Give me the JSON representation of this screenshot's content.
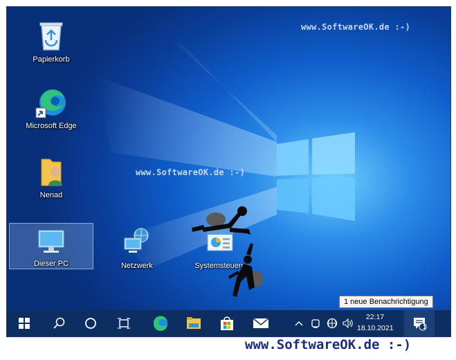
{
  "watermarks": {
    "top_right": "www.SoftwareOK.de :-)",
    "center": "www.SoftwareOK.de :-)",
    "footer": "www.SoftwareOK.de :-)"
  },
  "desktop_icons": {
    "recycle_bin": "Papierkorb",
    "edge": "Microsoft Edge",
    "user": "Nenad",
    "this_pc": "Dieser PC",
    "network": "Netzwerk",
    "control_panel": "Systemsteueru"
  },
  "taskbar": {
    "pinned": [
      "start-icon",
      "search-icon",
      "cortana-icon",
      "task-view-icon",
      "edge-icon",
      "file-explorer-icon",
      "store-icon",
      "mail-icon"
    ],
    "time": "22:17",
    "date": "18.10.2021",
    "notification_count": "1"
  },
  "tooltip": "1 neue Benachrichtigung",
  "colors": {
    "taskbar": "#0d2e63",
    "desktop_blue": "#0f5cc9"
  }
}
